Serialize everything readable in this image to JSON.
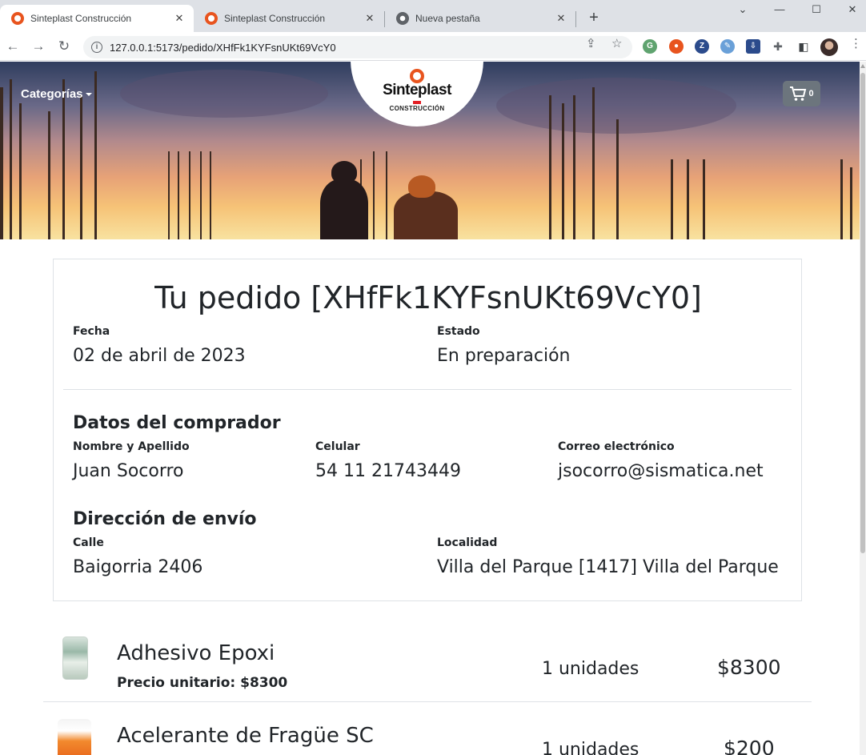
{
  "browser": {
    "tabs": [
      {
        "title": "Sinteplast Construcción",
        "active": true
      },
      {
        "title": "Sinteplast Construcción",
        "active": false
      },
      {
        "title": "Nueva pestaña",
        "active": false
      }
    ],
    "url": "127.0.0.1:5173/pedido/XHfFk1KYFsnUKt69VcY0"
  },
  "header": {
    "categories_label": "Categorías",
    "logo_name": "Sinteplast",
    "logo_sub": "CONSTRUCCIÓN",
    "cart_count": "0"
  },
  "order": {
    "title": "Tu pedido [XHfFk1KYFsnUKt69VcY0]",
    "fecha_label": "Fecha",
    "fecha": "02 de abril de 2023",
    "estado_label": "Estado",
    "estado": "En preparación",
    "buyer": {
      "heading": "Datos del comprador",
      "name_label": "Nombre y Apellido",
      "name": "Juan Socorro",
      "phone_label": "Celular",
      "phone": "54 11 21743449",
      "email_label": "Correo electrónico",
      "email": "jsocorro@sismatica.net"
    },
    "shipping": {
      "heading": "Dirección de envío",
      "street_label": "Calle",
      "street": "Baigorria 2406",
      "city_label": "Localidad",
      "city": "Villa del Parque [1417] Villa del Parque"
    }
  },
  "items": [
    {
      "name": "Adhesivo Epoxi",
      "unit_price": "Precio unitario: $8300",
      "qty": "1 unidades",
      "total": "$8300"
    },
    {
      "name": "Acelerante de Fragüe SC",
      "qty": "1 unidades",
      "total": "$200"
    }
  ]
}
